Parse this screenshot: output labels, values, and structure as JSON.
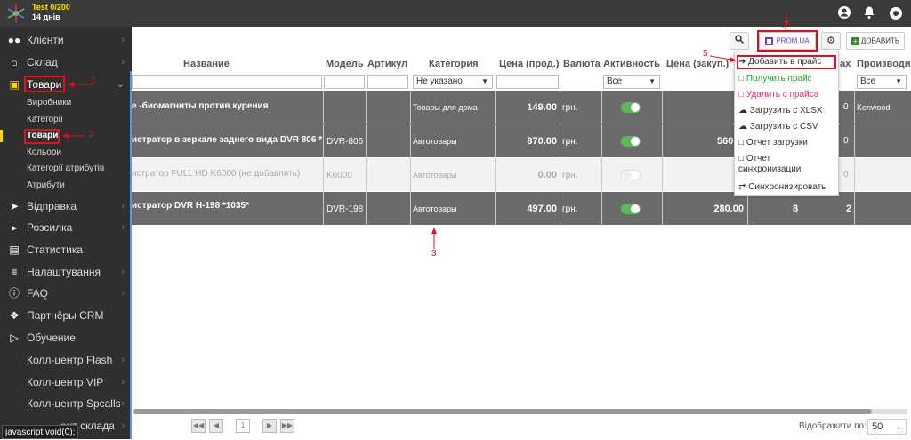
{
  "account": {
    "title": "Test 0/200",
    "days": "14 днів"
  },
  "sidebar": {
    "items": [
      {
        "icon": "users-icon",
        "label": "Клієнти"
      },
      {
        "icon": "warehouse-icon",
        "label": "Склад"
      },
      {
        "icon": "box-icon",
        "label": "Товари"
      },
      {
        "icon": "send-icon",
        "label": "Відправка"
      },
      {
        "icon": "bullhorn-icon",
        "label": "Розсилка"
      },
      {
        "icon": "chart-icon",
        "label": "Статистика"
      },
      {
        "icon": "sliders-icon",
        "label": "Налаштування"
      },
      {
        "icon": "info-icon",
        "label": "FAQ"
      },
      {
        "icon": "handshake-icon",
        "label": "Партнёры CRM"
      },
      {
        "icon": "play-icon",
        "label": "Обучение"
      },
      {
        "icon": "",
        "label": "Колл-центр Flash"
      },
      {
        "icon": "",
        "label": "Колл-центр VIP"
      },
      {
        "icon": "",
        "label": "Колл-центр Spcalls"
      },
      {
        "icon": "",
        "label": "ент склада"
      }
    ],
    "subitems": [
      "Виробники",
      "Категорії",
      "Товари",
      "Кольори",
      "Категорії атрибутів",
      "Атрибути"
    ]
  },
  "toolbar": {
    "prom": "PROM.UA",
    "add": "ДОБАВИТЬ"
  },
  "table": {
    "headers": [
      "Название",
      "Модель",
      "Артикул",
      "Категория",
      "Цена (прод.)",
      "Валюта",
      "Активность",
      "Цена (закуп.)",
      "ах",
      "Производи"
    ],
    "filters": {
      "category": "Не указано",
      "activity": "Все",
      "producer": "Все"
    },
    "rows": [
      {
        "name": "е -биомагниты против курения",
        "model": "",
        "category": "Товары для дома",
        "price": "149.00",
        "currency": "грн.",
        "active": true,
        "purchase": "",
        "qty": "",
        "stock": "0",
        "producer": "Kenwood"
      },
      {
        "name": "истратор в зеркале заднего вида DVR 806 *1037",
        "model": "DVR-806",
        "category": "Автотовары",
        "price": "870.00",
        "currency": "грн.",
        "active": true,
        "purchase": "560.",
        "qty": "",
        "stock": "0",
        "producer": ""
      },
      {
        "name": "истратор FULL HD K6000 (не добавлять)",
        "model": "K6000",
        "category": "Автотовары",
        "price": "0.00",
        "currency": "грн.",
        "active": false,
        "purchase": "",
        "qty": "",
        "stock": "0",
        "producer": ""
      },
      {
        "name": "истратор DVR H-198 *1035*",
        "model": "DVR-198",
        "category": "Автотовары",
        "price": "497.00",
        "currency": "грн.",
        "active": true,
        "purchase": "280.00",
        "qty": "8",
        "stock": "2",
        "producer": ""
      }
    ]
  },
  "menu": {
    "items": [
      "Добавить в прайс",
      "Получить прайс",
      "Удалить с прайса",
      "Загрузить с XLSX",
      "Загрузить с CSV",
      "Отчет загрузки",
      "Отчет",
      "синхронизации",
      "Синхронизировать"
    ]
  },
  "annotations": [
    "1",
    "2",
    "3",
    "4",
    "5"
  ],
  "pager": {
    "page": "1",
    "per_page_label": "Відображати по:",
    "per_page": "50"
  },
  "status": "javascript:void(0);",
  "colors": {
    "highlight": "#e01020",
    "toggle_on": "#5cb85c",
    "row_dark": "#6b6b6b",
    "add_button": "#2e8b2e"
  }
}
